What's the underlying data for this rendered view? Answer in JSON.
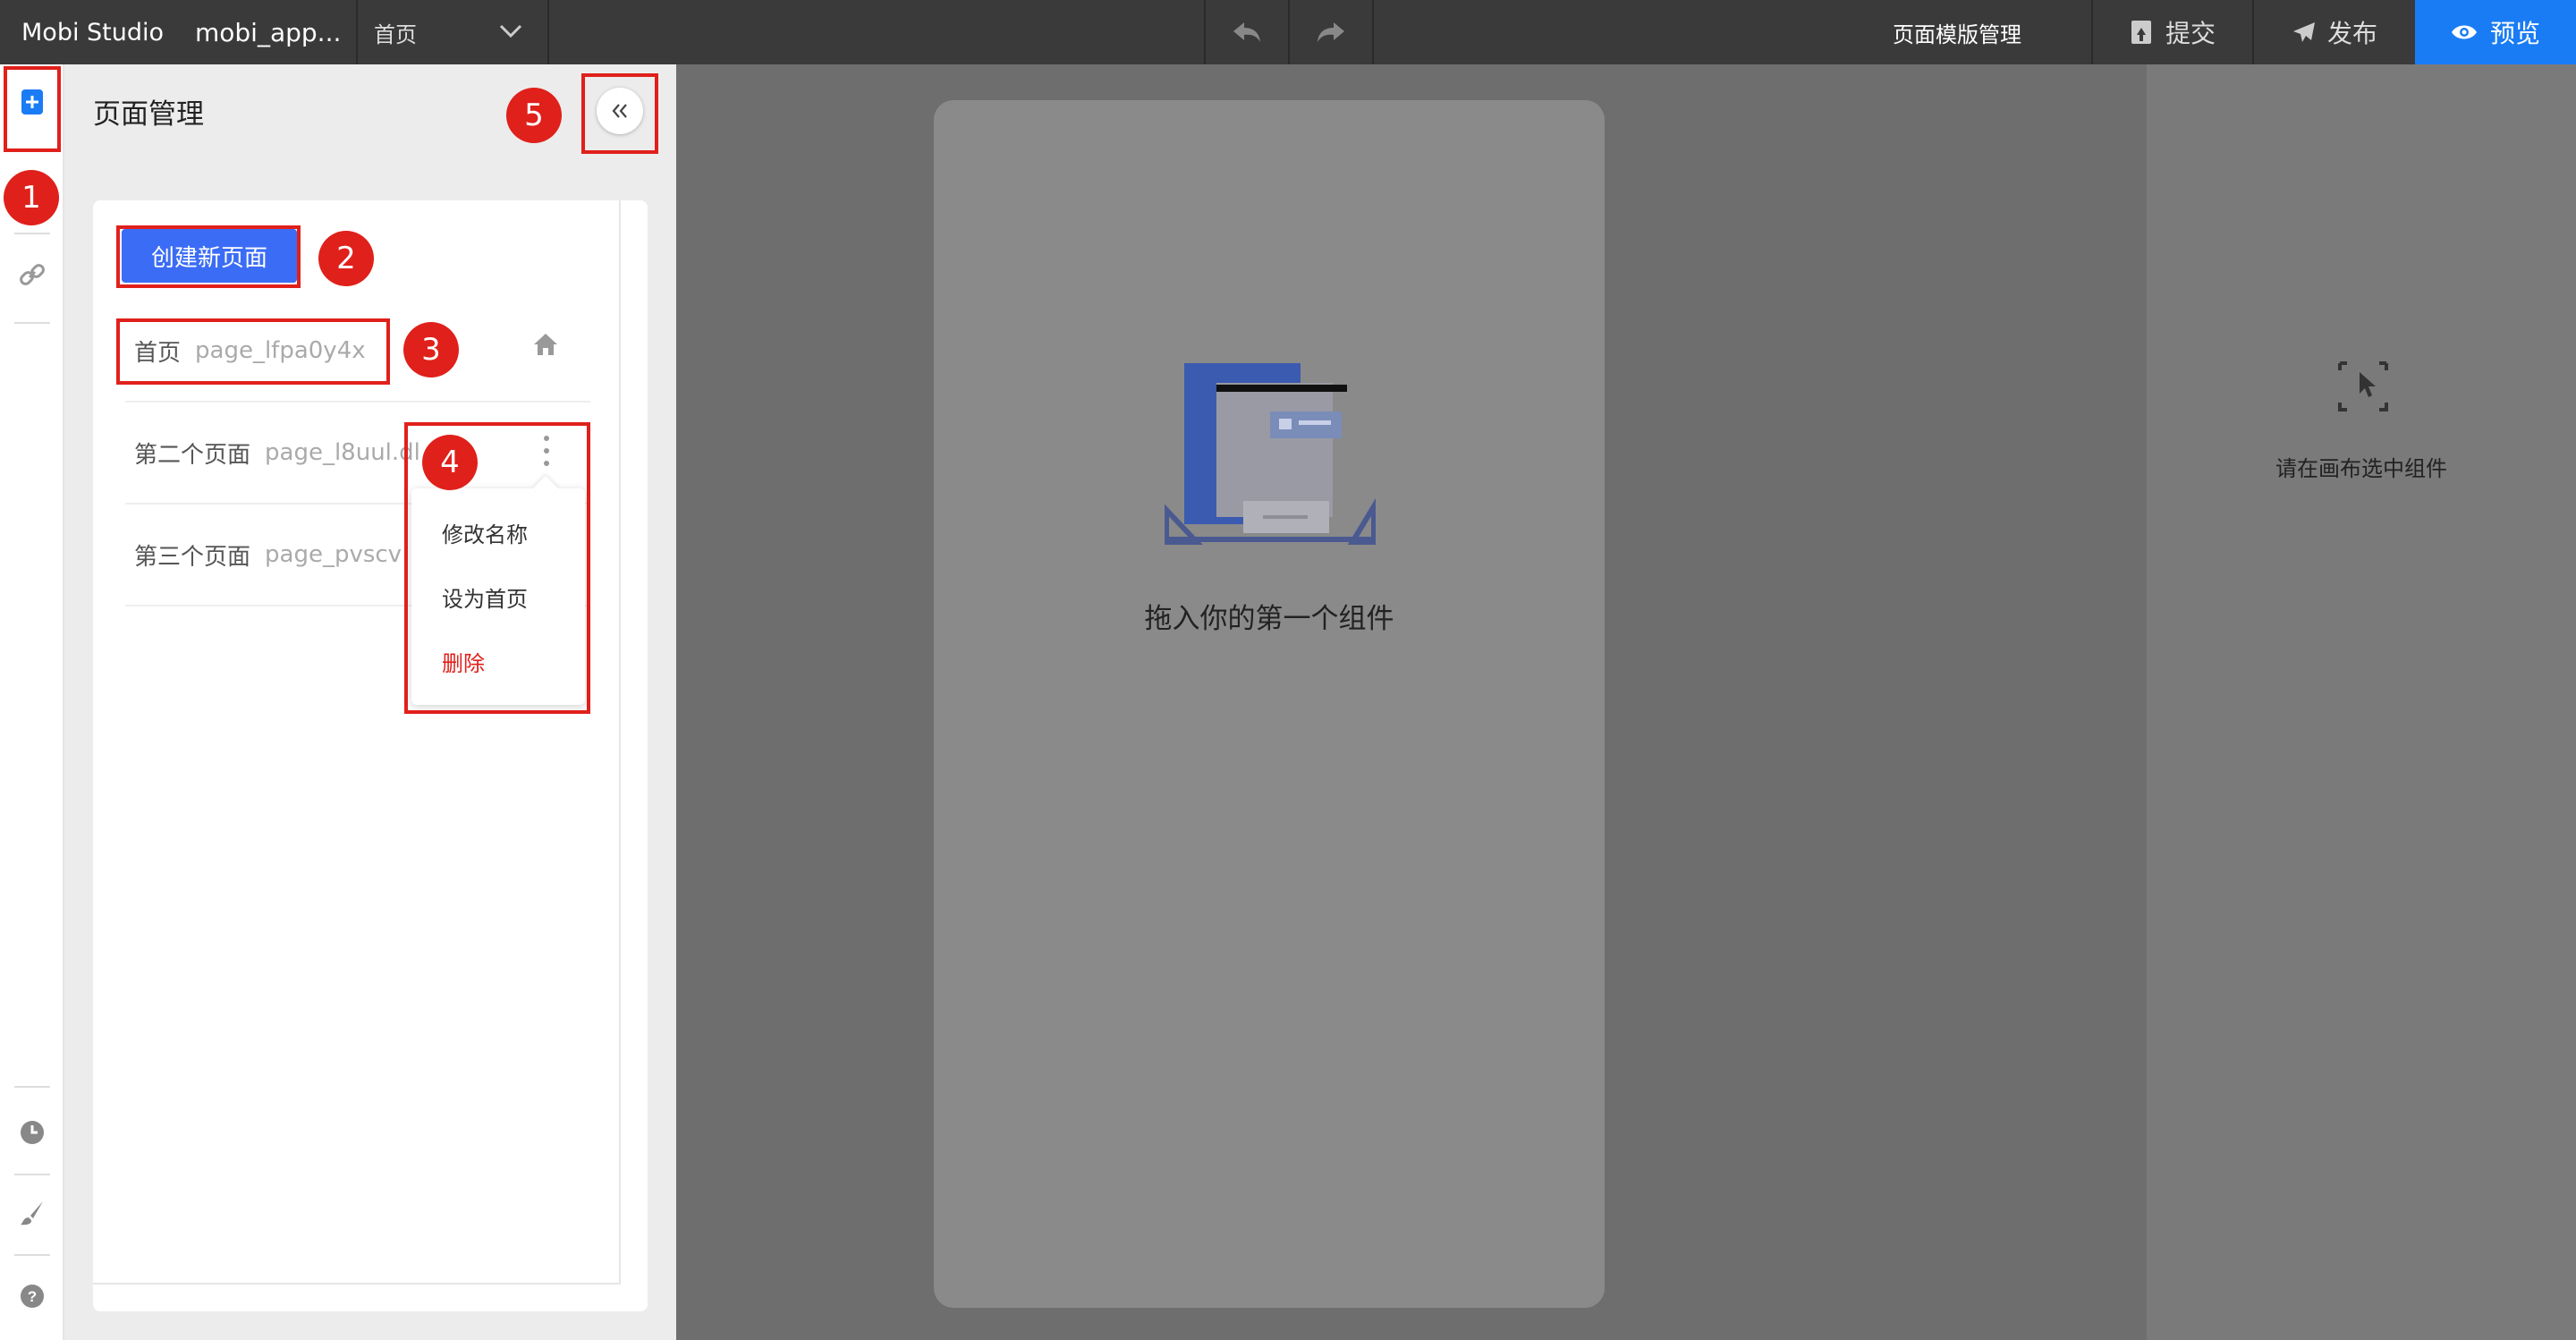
{
  "app": {
    "name": "Mobi Studio",
    "project": "mobi_app...",
    "current_page": "首页"
  },
  "toolbar": {
    "template_label": "页面模版管理",
    "submit_label": "提交",
    "publish_label": "发布",
    "preview_label": "预览"
  },
  "panel": {
    "title": "页面管理",
    "create_label": "创建新页面",
    "pages": [
      {
        "name": "首页",
        "id": "page_lfpa0y4x"
      },
      {
        "name": "第二个页面",
        "id": "page_l8uul.dl"
      },
      {
        "name": "第三个页面",
        "id": "page_pvscv"
      }
    ],
    "menu": {
      "rename": "修改名称",
      "set_home": "设为首页",
      "delete": "删除"
    }
  },
  "canvas": {
    "empty_text": "拖入你的第一个组件"
  },
  "right_panel": {
    "hint": "请在画布选中组件"
  },
  "annotations": [
    "1",
    "2",
    "3",
    "4",
    "5"
  ],
  "colors": {
    "accent": "#1a7cf5",
    "create_button": "#3b6cf5",
    "annotation": "#e0201b",
    "delete": "#e0201b"
  },
  "icons": [
    "add-page-icon",
    "link-icon",
    "clock-icon",
    "brush-icon",
    "help-icon",
    "chevron-down-icon",
    "undo-icon",
    "redo-icon",
    "submit-icon",
    "send-icon",
    "eye-icon",
    "collapse-icon",
    "home-icon",
    "more-vertical-icon",
    "select-cursor-icon",
    "empty-canvas-illustration"
  ]
}
